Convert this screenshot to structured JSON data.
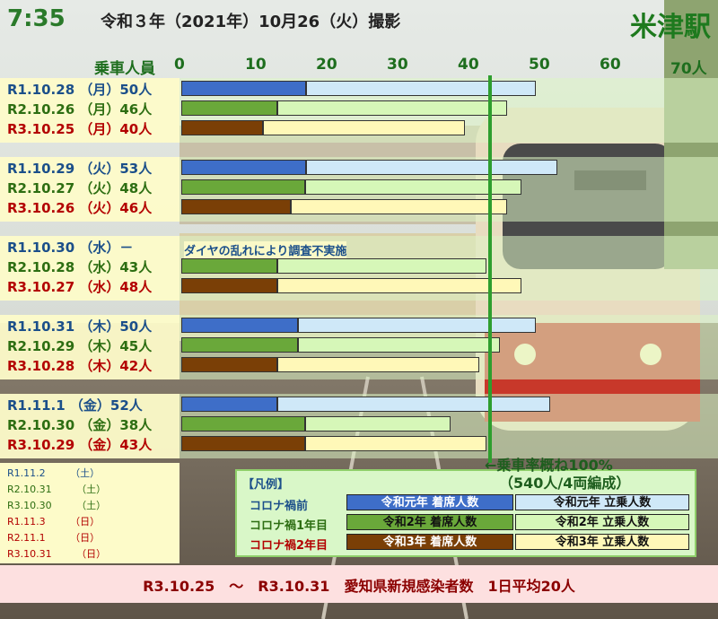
{
  "header": {
    "time": "7:35",
    "date": "令和３年（2021年）10月26（火）撮影",
    "station": "米津駅"
  },
  "chart_data": {
    "type": "bar",
    "orientation": "horizontal",
    "stacked": true,
    "axis_title": "乗車人員",
    "x_ticks": [
      "0",
      "10",
      "20",
      "30",
      "40",
      "50",
      "60",
      "70人"
    ],
    "xlim": [
      0,
      70
    ],
    "reference_line": {
      "value": 43,
      "label_line1": "←乗車率概ね100%",
      "label_line2": "（540人/4両編成）",
      "color": "#2e9e2e"
    },
    "groups": [
      {
        "rows": [
          {
            "label": "R1.10.28 （月）50人",
            "era": "r1",
            "seated": 17.6,
            "standing": 32.4,
            "total": 50
          },
          {
            "label": "R2.10.26 （月）46人",
            "era": "r2",
            "seated": 13.5,
            "standing": 32.5,
            "total": 46
          },
          {
            "label": "R3.10.25 （月）40人",
            "era": "r3",
            "seated": 11.5,
            "standing": 28.5,
            "total": 40
          }
        ]
      },
      {
        "rows": [
          {
            "label": "R1.10.29 （火）53人",
            "era": "r1",
            "seated": 17.6,
            "standing": 35.4,
            "total": 53
          },
          {
            "label": "R2.10.27 （火）48人",
            "era": "r2",
            "seated": 17.5,
            "standing": 30.5,
            "total": 48
          },
          {
            "label": "R3.10.26 （火）46人",
            "era": "r3",
            "seated": 15.5,
            "standing": 30.5,
            "total": 46
          }
        ]
      },
      {
        "rows": [
          {
            "label": "R1.10.30 （水）－",
            "era": "r1",
            "seated": 0,
            "standing": 0,
            "total": null
          },
          {
            "label": "R2.10.28 （水）43人",
            "era": "r2",
            "seated": 13.5,
            "standing": 29.5,
            "total": 43
          },
          {
            "label": "R3.10.27 （水）48人",
            "era": "r3",
            "seated": 13.5,
            "standing": 34.5,
            "total": 48
          }
        ]
      },
      {
        "rows": [
          {
            "label": "R1.10.31 （木）50人",
            "era": "r1",
            "seated": 16.5,
            "standing": 33.5,
            "total": 50
          },
          {
            "label": "R2.10.29 （木）45人",
            "era": "r2",
            "seated": 16.5,
            "standing": 28.5,
            "total": 45
          },
          {
            "label": "R3.10.28 （木）42人",
            "era": "r3",
            "seated": 13.5,
            "standing": 28.5,
            "total": 42
          }
        ]
      },
      {
        "rows": [
          {
            "label": "R1.11.1 （金）52人",
            "era": "r1",
            "seated": 13.5,
            "standing": 38.5,
            "total": 52
          },
          {
            "label": "R2.10.30 （金）38人",
            "era": "r2",
            "seated": 17.5,
            "standing": 20.5,
            "total": 38
          },
          {
            "label": "R3.10.29 （金）43人",
            "era": "r3",
            "seated": 17.5,
            "standing": 25.5,
            "total": 43
          }
        ]
      }
    ],
    "annotation": "ダイヤの乱れにより調査不実施",
    "weekend_rows": [
      {
        "label": "R1.11.2　　　（土）",
        "era": "r1"
      },
      {
        "label": "R2.10.31　　　（土）",
        "era": "r2"
      },
      {
        "label": "R3.10.30　　　（土）",
        "era": "r2"
      },
      {
        "label": "R1.11.3　　　（日）",
        "era": "r3"
      },
      {
        "label": "R2.11.1　　　（日）",
        "era": "r3"
      },
      {
        "label": "R3.10.31　　　（日）",
        "era": "r3"
      }
    ],
    "legend": {
      "title": "【凡例】",
      "rows": [
        {
          "name": "コロナ禍前",
          "seated_label": "令和元年 着席人数",
          "standing_label": "令和元年 立乗人数",
          "era": "r1"
        },
        {
          "name": "コロナ禍1年目",
          "seated_label": "令和2年 着席人数",
          "standing_label": "令和2年 立乗人数",
          "era": "r2"
        },
        {
          "name": "コロナ禍2年目",
          "seated_label": "令和3年 着席人数",
          "standing_label": "令和3年 立乗人数",
          "era": "r3"
        }
      ]
    },
    "colors": {
      "r1_seated": "#3e6ec8",
      "r1_standing": "#cfe8f8",
      "r1_text": "#1b4f8a",
      "r2_seated": "#6aa83a",
      "r2_standing": "#d6f7b8",
      "r2_text": "#2d6e12",
      "r3_seated": "#7a3f06",
      "r3_standing": "#fff8b8",
      "r3_text": "#b30000",
      "row_band": "#fdfbc9",
      "row_band_alt": "#ddf4c4"
    }
  },
  "footer": {
    "text": "R3.10.25　～　R3.10.31　愛知県新規感染者数　1日平均20人"
  }
}
